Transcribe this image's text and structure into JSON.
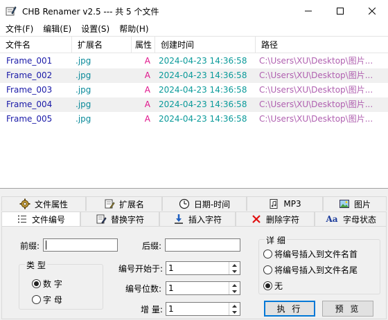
{
  "window": {
    "title": "CHB Renamer v2.5 --- 共 5 个文件"
  },
  "menu": [
    "文件(F)",
    "编辑(E)",
    "设置(S)",
    "帮助(H)"
  ],
  "list": {
    "columns": [
      "文件名",
      "扩展名",
      "属性",
      "创建时间",
      "路径"
    ],
    "rows": [
      {
        "name": "Frame_001",
        "ext": ".jpg",
        "attr": "A",
        "time": "2024-04-23 14:36:58",
        "path": "C:\\Users\\XU\\Desktop\\图片..."
      },
      {
        "name": "Frame_002",
        "ext": ".jpg",
        "attr": "A",
        "time": "2024-04-23 14:36:58",
        "path": "C:\\Users\\XU\\Desktop\\图片..."
      },
      {
        "name": "Frame_003",
        "ext": ".jpg",
        "attr": "A",
        "time": "2024-04-23 14:36:58",
        "path": "C:\\Users\\XU\\Desktop\\图片..."
      },
      {
        "name": "Frame_004",
        "ext": ".jpg",
        "attr": "A",
        "time": "2024-04-23 14:36:58",
        "path": "C:\\Users\\XU\\Desktop\\图片..."
      },
      {
        "name": "Frame_005",
        "ext": ".jpg",
        "attr": "A",
        "time": "2024-04-23 14:36:58",
        "path": "C:\\Users\\XU\\Desktop\\图片..."
      }
    ]
  },
  "tabs_row1": [
    {
      "label": "文件属性",
      "icon": "gear-icon"
    },
    {
      "label": "扩展名",
      "icon": "document-edit-icon"
    },
    {
      "label": "日期-时间",
      "icon": "clock-icon"
    },
    {
      "label": "MP3",
      "icon": "music-file-icon"
    },
    {
      "label": "图片",
      "icon": "picture-icon"
    }
  ],
  "tabs_row2": [
    {
      "label": "文件编号",
      "icon": "numbered-list-icon",
      "active": true
    },
    {
      "label": "替换字符",
      "icon": "replace-icon"
    },
    {
      "label": "插入字符",
      "icon": "insert-arrow-icon"
    },
    {
      "label": "删除字符",
      "icon": "delete-x-icon"
    },
    {
      "label": "字母状态",
      "icon": "letter-case-icon",
      "glyph": "Aa"
    }
  ],
  "form": {
    "prefix_label": "前缀:",
    "prefix_value": "",
    "suffix_label": "后缀:",
    "suffix_value": "",
    "type_group": "类 型",
    "type_options": [
      {
        "label": "数 字",
        "checked": true
      },
      {
        "label": "字 母",
        "checked": false
      }
    ],
    "start_label": "编号开始于:",
    "start_value": "1",
    "digits_label": "编号位数:",
    "digits_value": "1",
    "step_label": "增 量:",
    "step_value": "1",
    "detail_group": "详 细",
    "detail_options": [
      {
        "label": "将编号插入到文件名首",
        "checked": false
      },
      {
        "label": "将编号插入到文件名尾",
        "checked": false
      },
      {
        "label": "无",
        "checked": true
      }
    ],
    "execute_label": "执 行",
    "preview_label": "预 览"
  },
  "colors": {
    "name": "#1a1aa8",
    "ext": "#0a8a9a",
    "attr": "#e0108a",
    "time": "#0a9a9a",
    "path": "#b060b0",
    "default_button_border": "#0078d7"
  }
}
